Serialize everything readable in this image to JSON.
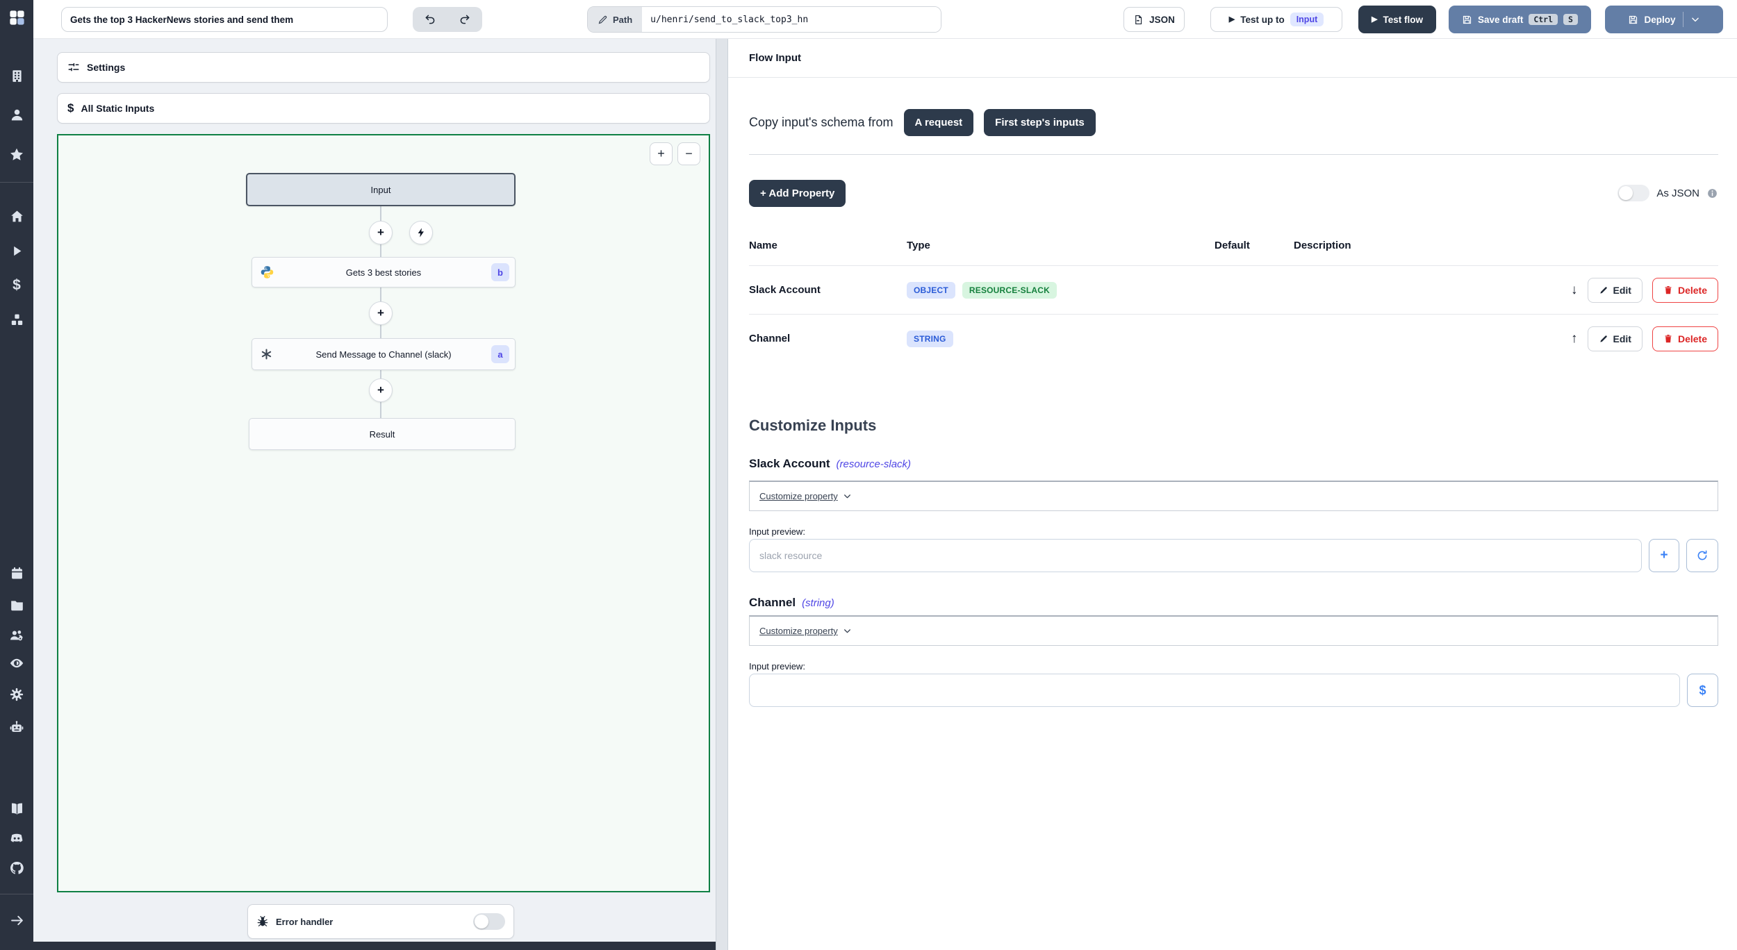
{
  "topbar": {
    "flow_title_value": "Gets the top 3 HackerNews stories and send them",
    "path_label": "Path",
    "path_value": "u/henri/send_to_slack_top3_hn",
    "json_label": "JSON",
    "test_up_to_label": "Test up to",
    "test_up_to_target": "Input",
    "test_flow_label": "Test flow",
    "save_draft_label": "Save draft",
    "save_draft_kbd": [
      "Ctrl",
      "S"
    ],
    "deploy_label": "Deploy"
  },
  "sidebar": {
    "icons": [
      "workspace-building",
      "user",
      "favorites-star",
      "home",
      "runs-play",
      "variables-dollar",
      "resources-cubes",
      "schedules-calendar",
      "folders",
      "groups-users",
      "audit-eye",
      "settings-gear",
      "workers-robot",
      "docs-book",
      "discord",
      "github",
      "collapse-arrow"
    ]
  },
  "flow_panel": {
    "settings_label": "Settings",
    "static_inputs_label": "All Static Inputs",
    "zoom_in": "+",
    "zoom_out": "−",
    "nodes": {
      "input": "Input",
      "step_b_label": "Gets 3 best stories",
      "step_b_badge": "b",
      "step_a_label": "Send Message to Channel (slack)",
      "step_a_badge": "a",
      "result": "Result"
    },
    "error_handler_label": "Error handler"
  },
  "flow_input": {
    "title": "Flow Input",
    "copy_schema_label": "Copy input's schema from",
    "copy_from_request": "A request",
    "copy_from_first_step": "First step's inputs",
    "add_property_label": "+ Add Property",
    "as_json_label": "As JSON",
    "table": {
      "headers": [
        "Name",
        "Type",
        "Default",
        "Description"
      ],
      "rows": [
        {
          "name": "Slack Account",
          "badges": [
            "OBJECT",
            "RESOURCE-SLACK"
          ],
          "move": "↓",
          "edit": "Edit",
          "delete": "Delete"
        },
        {
          "name": "Channel",
          "badges": [
            "STRING"
          ],
          "move": "↑",
          "edit": "Edit",
          "delete": "Delete"
        }
      ]
    },
    "customize": {
      "title": "Customize Inputs",
      "sections": [
        {
          "name": "Slack Account",
          "type": "(resource-slack)",
          "customize_label": "Customize property",
          "preview_label": "Input preview:",
          "placeholder": "slack resource"
        },
        {
          "name": "Channel",
          "type": "(string)",
          "customize_label": "Customize property",
          "preview_label": "Input preview:",
          "placeholder": ""
        }
      ]
    }
  },
  "glyphs": {
    "play": "▶",
    "dollar": "$"
  },
  "colors": {
    "accent_dark": "#2d3a4b",
    "accent_slate": "#637ea6",
    "selection_green": "#0f8044",
    "indigo": "#4f46e5",
    "delete_red": "#dc2626",
    "sidebar_bg": "#2b323f"
  }
}
